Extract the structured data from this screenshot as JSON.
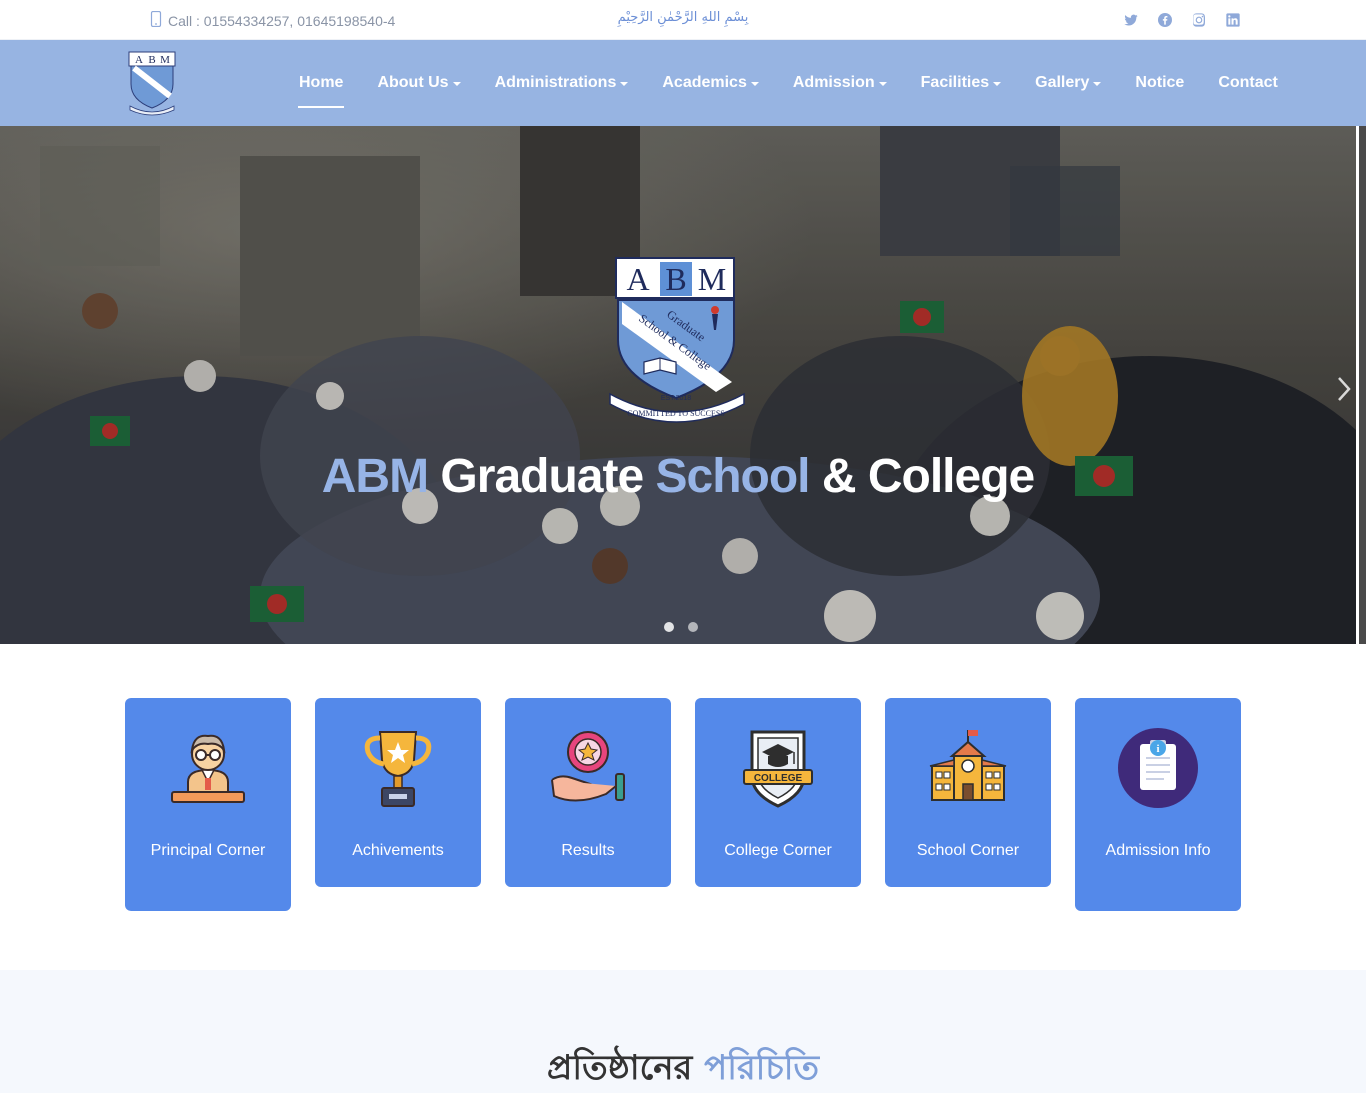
{
  "topbar": {
    "call": "Call : 01554334257, 01645198540-4",
    "bismillah": "بِسْمِ اللهِ الرَّحْمٰنِ الرَّحِيْمِ",
    "social": [
      "twitter-icon",
      "facebook-icon",
      "instagram-icon",
      "linkedin-icon"
    ]
  },
  "logo": {
    "letters": [
      "A",
      "B",
      "M"
    ]
  },
  "nav": {
    "items": [
      {
        "label": "Home",
        "dropdown": false,
        "active": true
      },
      {
        "label": "About Us",
        "dropdown": true,
        "active": false
      },
      {
        "label": "Administrations",
        "dropdown": true,
        "active": false
      },
      {
        "label": "Academics",
        "dropdown": true,
        "active": false
      },
      {
        "label": "Admission",
        "dropdown": true,
        "active": false
      },
      {
        "label": "Facilities",
        "dropdown": true,
        "active": false
      },
      {
        "label": "Gallery",
        "dropdown": true,
        "active": false
      },
      {
        "label": "Notice",
        "dropdown": false,
        "active": false
      },
      {
        "label": "Contact",
        "dropdown": false,
        "active": false
      }
    ]
  },
  "hero": {
    "title": {
      "part1": "ABM",
      "part2": "Graduate",
      "part3": "School",
      "part4": "& College"
    },
    "crest": {
      "letters": [
        "A",
        "B",
        "M"
      ],
      "text1": "Graduate",
      "text2": "School & College",
      "est": "EST:2018",
      "motto": "COMMITTED TO SUCCESS"
    },
    "slides": 2,
    "active_slide": 1
  },
  "cards": [
    {
      "label": "Principal Corner",
      "icon": "principal-icon"
    },
    {
      "label": "Achivements",
      "icon": "trophy-icon"
    },
    {
      "label": "Results",
      "icon": "results-badge-icon"
    },
    {
      "label": "College Corner",
      "icon": "college-crest-icon"
    },
    {
      "label": "School Corner",
      "icon": "school-building-icon"
    },
    {
      "label": "Admission Info",
      "icon": "admission-clipboard-icon"
    }
  ],
  "intro": {
    "title_part1": "প্রতিষ্ঠানের",
    "title_part2": "পরিচিতি"
  },
  "colors": {
    "nav_bg": "#97b4e2",
    "card_bg": "#5489ea",
    "accent": "#97b4e6"
  }
}
